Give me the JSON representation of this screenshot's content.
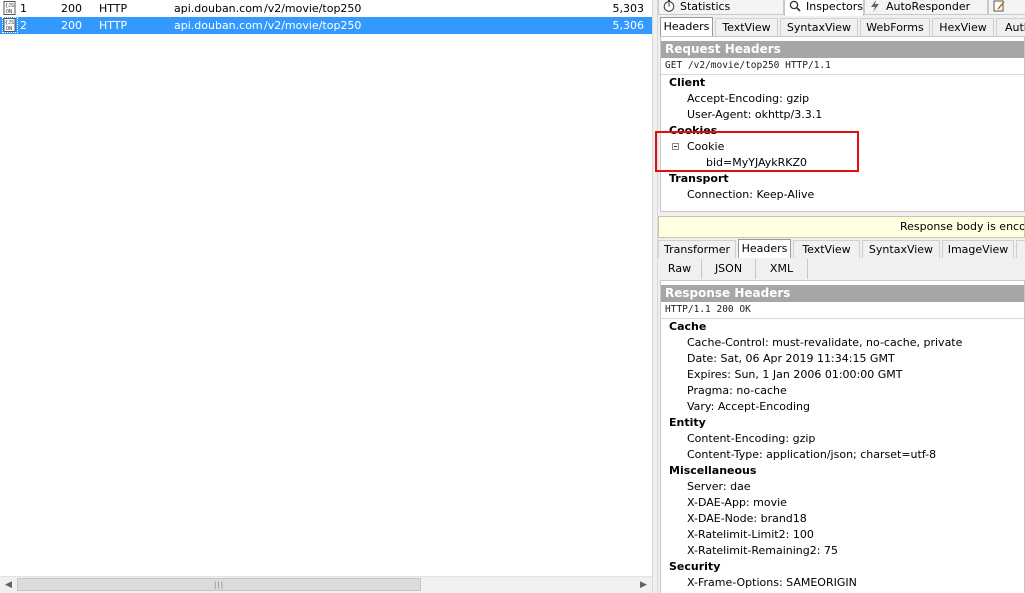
{
  "sessions": [
    {
      "num": "1",
      "result": "200",
      "protocol": "HTTP",
      "host": "api.douban.com",
      "url": "/v2/movie/top250",
      "body": "5,303",
      "icon": "json-document-icon",
      "selected": false
    },
    {
      "num": "2",
      "result": "200",
      "protocol": "HTTP",
      "host": "api.douban.com",
      "url": "/v2/movie/top250",
      "body": "5,306",
      "icon": "json-document-icon",
      "selected": true
    }
  ],
  "scrollbar": {
    "grip": "|||"
  },
  "top_tabs": [
    {
      "label": "Statistics",
      "icon": "stopwatch-icon"
    },
    {
      "label": "Inspectors",
      "icon": "magnifier-icon"
    },
    {
      "label": "AutoResponder",
      "icon": "lightning-icon"
    },
    {
      "label": "",
      "icon": "note-icon"
    }
  ],
  "request": {
    "tabs": [
      "Headers",
      "TextView",
      "SyntaxView",
      "WebForms",
      "HexView",
      "Auth"
    ],
    "active_tab": "Headers",
    "section_title": "Request Headers",
    "status_line": "GET /v2/movie/top250 HTTP/1.1",
    "groups": [
      {
        "name": "Client",
        "items": [
          "Accept-Encoding: gzip",
          "User-Agent: okhttp/3.3.1"
        ]
      },
      {
        "name": "Cookies",
        "items": [],
        "tree": {
          "name": "Cookie",
          "children": [
            "bid=MyYJAykRKZ0"
          ]
        }
      },
      {
        "name": "Transport",
        "items": [
          "Connection: Keep-Alive"
        ]
      }
    ]
  },
  "notice": "Response body is encoded. Click to decode.",
  "response": {
    "tabs": [
      "Transformer",
      "Headers",
      "TextView",
      "SyntaxView",
      "ImageView",
      ""
    ],
    "active_tab": "Headers",
    "sub_tabs": [
      "Raw",
      "JSON",
      "XML"
    ],
    "section_title": "Response Headers",
    "status_line": "HTTP/1.1 200 OK",
    "groups": [
      {
        "name": "Cache",
        "items": [
          "Cache-Control: must-revalidate, no-cache, private",
          "Date: Sat, 06 Apr 2019 11:34:15 GMT",
          "Expires: Sun, 1 Jan 2006 01:00:00 GMT",
          "Pragma: no-cache",
          "Vary: Accept-Encoding"
        ]
      },
      {
        "name": "Entity",
        "items": [
          "Content-Encoding: gzip",
          "Content-Type: application/json; charset=utf-8"
        ]
      },
      {
        "name": "Miscellaneous",
        "items": [
          "Server: dae",
          "X-DAE-App: movie",
          "X-DAE-Node: brand18",
          "X-Ratelimit-Limit2: 100",
          "X-Ratelimit-Remaining2: 75"
        ]
      },
      {
        "name": "Security",
        "items": [
          "X-Frame-Options: SAMEORIGIN"
        ]
      }
    ]
  },
  "colors": {
    "selection": "#3399ff",
    "section_bar": "#a6a6a6",
    "highlight_box": "#e01010",
    "notice_bg": "#ffffe1"
  }
}
